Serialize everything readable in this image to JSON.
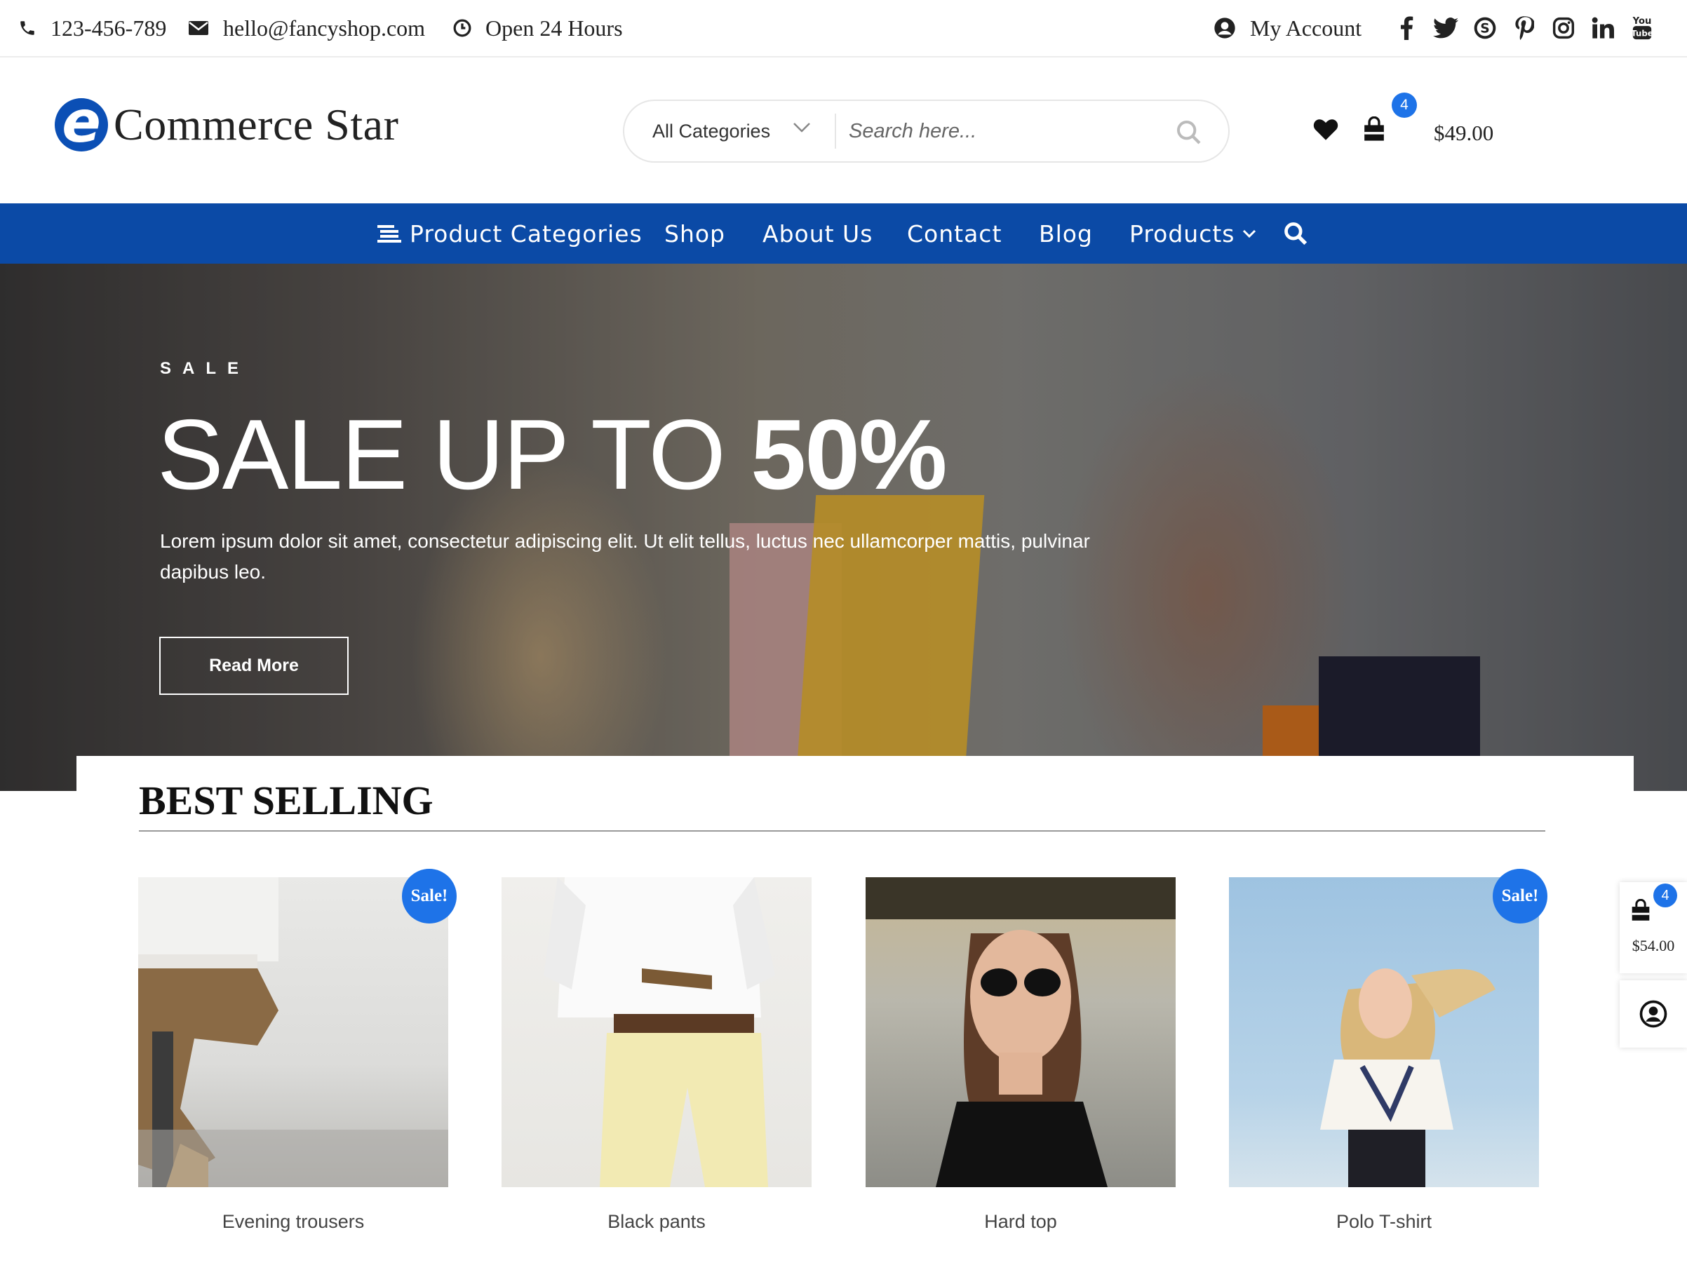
{
  "topbar": {
    "phone": "123-456-789",
    "email": "hello@fancyshop.com",
    "hours": "Open 24 Hours",
    "account": "My Account",
    "social": [
      "facebook-icon",
      "twitter-icon",
      "skype-icon",
      "pinterest-icon",
      "instagram-icon",
      "linkedin-icon",
      "youtube-icon"
    ]
  },
  "header": {
    "logo_mark": "e",
    "logo_text": "Commerce Star",
    "category_select": "All Categories",
    "search_placeholder": "Search here...",
    "cart_count": "4",
    "cart_total": "$49.00"
  },
  "nav": {
    "items": [
      "Product Categories",
      "Shop",
      "About Us",
      "Contact",
      "Blog",
      "Products"
    ]
  },
  "hero": {
    "kicker": "SALE",
    "title_light": "SALE UP TO ",
    "title_bold": "50%",
    "text": "Lorem ipsum dolor sit amet, consectetur adipiscing elit. Ut elit tellus, luctus nec ullamcorper mattis, pulvinar dapibus leo.",
    "button": "Read More"
  },
  "best_selling": {
    "title": "BEST SELLING",
    "sale_label": "Sale!",
    "products": [
      {
        "name": "Evening trousers",
        "sale": true
      },
      {
        "name": "Black pants",
        "sale": false
      },
      {
        "name": "Hard top",
        "sale": false
      },
      {
        "name": "Polo T-shirt",
        "sale": true
      }
    ]
  },
  "side_widget": {
    "cart_count": "4",
    "cart_total": "$54.00"
  },
  "colors": {
    "brand_blue": "#0b4aa6",
    "accent_blue": "#1e73e8"
  }
}
